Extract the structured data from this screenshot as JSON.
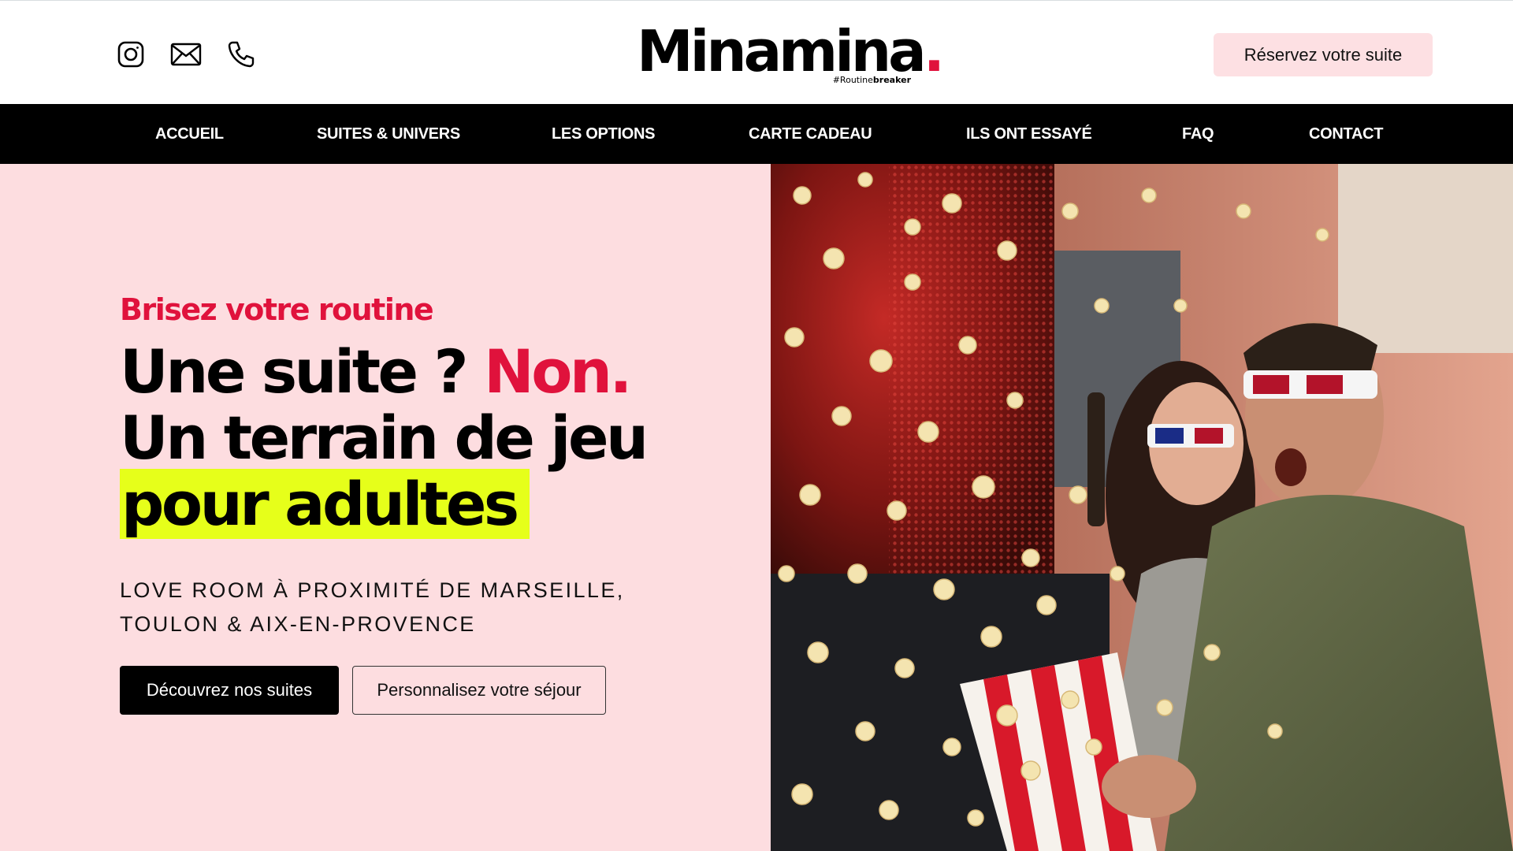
{
  "header": {
    "social_icons": [
      "instagram-icon",
      "mail-icon",
      "phone-icon"
    ],
    "logo_text": "Minamina",
    "logo_dot": ".",
    "logo_tag_prefix": "#Routine",
    "logo_tag_suffix": "breaker",
    "reserve_label": "Réservez votre suite"
  },
  "nav": {
    "items": [
      "ACCUEIL",
      "SUITES & UNIVERS",
      "LES OPTIONS",
      "CARTE CADEAU",
      "ILS ONT ESSAYÉ",
      "FAQ",
      "CONTACT"
    ]
  },
  "hero": {
    "kicker": "Brisez votre routine",
    "headline_line1_a": "Une suite ? ",
    "headline_line1_b": "Non.",
    "headline_line2": "Un terrain de jeu",
    "headline_line3": "pour adultes",
    "subline_1": "LOVE ROOM À PROXIMITÉ DE MARSEILLE,",
    "subline_2": "TOULON & AIX-EN-PROVENCE",
    "cta_primary": "Découvrez nos suites",
    "cta_secondary": "Personnalisez votre séjour"
  },
  "colors": {
    "accent_red": "#e0123c",
    "hero_bg_pink": "#fddde0",
    "highlight_yellow": "#e6ff1a",
    "nav_bg": "#000000",
    "reserve_btn_bg": "#fde0e3"
  }
}
